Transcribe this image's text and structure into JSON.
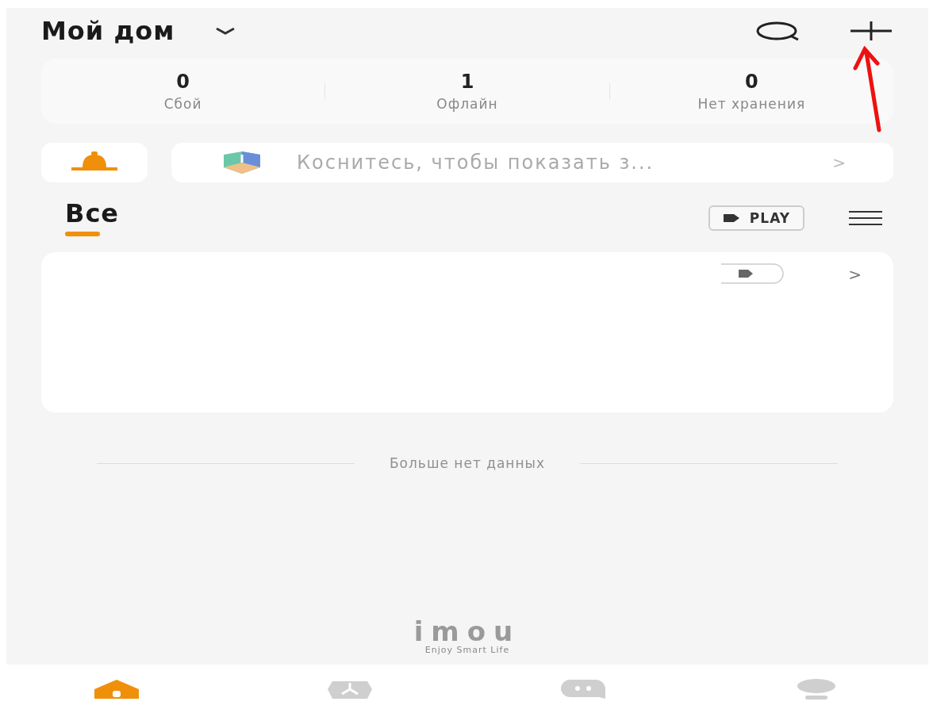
{
  "header": {
    "title": "Мой дом"
  },
  "stats": [
    {
      "value": "0",
      "label": "Сбой"
    },
    {
      "value": "1",
      "label": "Офлайн"
    },
    {
      "value": "0",
      "label": "Нет хранения"
    }
  ],
  "notice": {
    "text": "Коснитесь, чтобы показать з...",
    "arrow": ">"
  },
  "tabs": [
    {
      "label": "Все",
      "selected": true
    }
  ],
  "play_button": {
    "label": "PLAY"
  },
  "device_card": {
    "arrow": ">"
  },
  "end_message": "Больше нет данных",
  "logo": {
    "wordmark": "imou",
    "slogan": "Enjoy Smart Life"
  },
  "nav": [
    {
      "kind": "home",
      "selected": true
    },
    {
      "kind": "discover",
      "selected": false
    },
    {
      "kind": "messages",
      "selected": false
    },
    {
      "kind": "profile",
      "selected": false
    }
  ]
}
